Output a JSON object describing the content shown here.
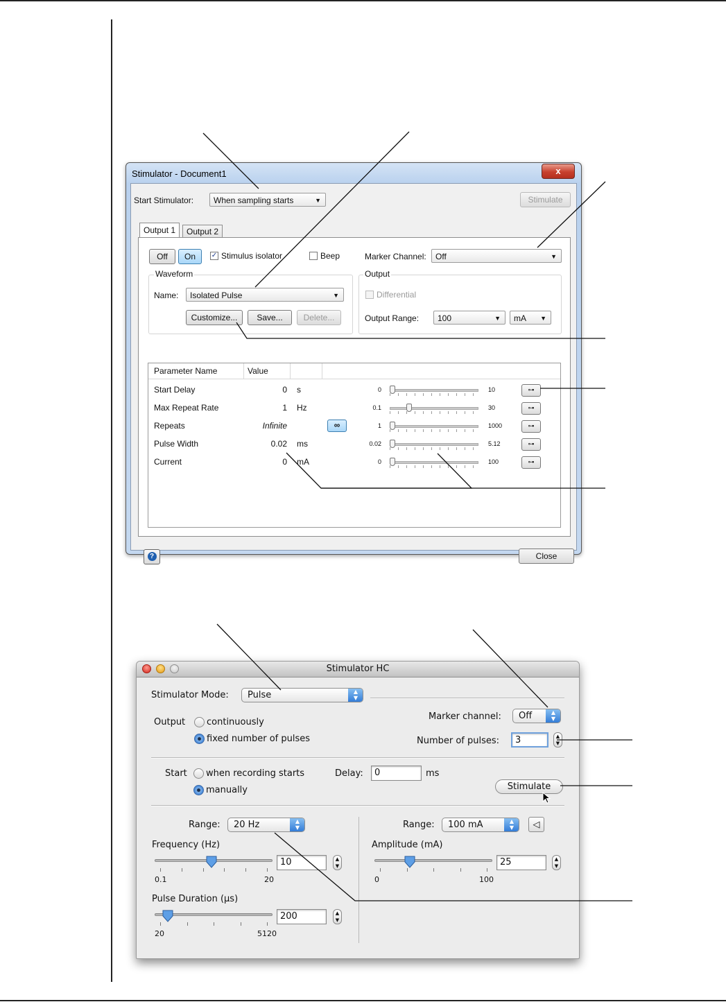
{
  "windows_dialog": {
    "title": "Stimulator - Document1",
    "close_glyph": "x",
    "start_stimulator_label": "Start Stimulator:",
    "start_stimulator_value": "When sampling starts",
    "stimulate_label": "Stimulate",
    "tabs": [
      "Output 1",
      "Output 2"
    ],
    "off_label": "Off",
    "on_label": "On",
    "stimulus_isolator_label": "Stimulus isolator",
    "stimulus_isolator_checked": true,
    "beep_label": "Beep",
    "beep_checked": false,
    "marker_channel_label": "Marker Channel:",
    "marker_channel_value": "Off",
    "waveform_group": "Waveform",
    "name_label": "Name:",
    "name_value": "Isolated Pulse",
    "customize_label": "Customize...",
    "save_label": "Save...",
    "delete_label": "Delete...",
    "output_group": "Output",
    "differential_label": "Differential",
    "output_range_label": "Output Range:",
    "output_range_value": "100",
    "output_unit_value": "mA",
    "table_headers": [
      "Parameter Name",
      "Value"
    ],
    "parameters": [
      {
        "name": "Start Delay",
        "value": "0",
        "unit": "s",
        "min": "0",
        "max": "10",
        "fraction": 0.0
      },
      {
        "name": "Max Repeat Rate",
        "value": "1",
        "unit": "Hz",
        "min": "0.1",
        "max": "30",
        "fraction": 0.2
      },
      {
        "name": "Repeats",
        "value": "Infinite",
        "unit": "",
        "min": "1",
        "max": "1000",
        "fraction": 0.0
      },
      {
        "name": "Pulse Width",
        "value": "0.02",
        "unit": "ms",
        "min": "0.02",
        "max": "5.12",
        "fraction": 0.0
      },
      {
        "name": "Current",
        "value": "0",
        "unit": "mA",
        "min": "0",
        "max": "100",
        "fraction": 0.0
      }
    ],
    "infinite_glyph": "∞",
    "help_glyph": "?",
    "close_label": "Close"
  },
  "mac_dialog": {
    "title": "Stimulator HC",
    "mode_label": "Stimulator Mode:",
    "mode_value": "Pulse",
    "output_label": "Output",
    "output_continuously": "continuously",
    "output_fixed": "fixed number of pulses",
    "marker_channel_label": "Marker channel:",
    "marker_channel_value": "Off",
    "number_of_pulses_label": "Number of pulses:",
    "number_of_pulses_value": "3",
    "start_label": "Start",
    "start_when_recording": "when recording starts",
    "start_manually": "manually",
    "delay_label": "Delay:",
    "delay_value": "0",
    "delay_unit": "ms",
    "stimulate_label": "Stimulate",
    "freq_range_label": "Range:",
    "freq_range_value": "20 Hz",
    "frequency_label": "Frequency (Hz)",
    "frequency_value": "10",
    "frequency_min": "0.1",
    "frequency_max": "20",
    "frequency_fraction": 0.48,
    "pulse_duration_label": "Pulse Duration (µs)",
    "pulse_duration_value": "200",
    "pulse_min": "20",
    "pulse_max": "5120",
    "pulse_fraction": 0.07,
    "amp_range_label": "Range:",
    "amp_range_value": "100 mA",
    "amplitude_label": "Amplitude (mA)",
    "amplitude_value": "25",
    "amplitude_min": "0",
    "amplitude_max": "100",
    "amplitude_fraction": 0.28,
    "speaker_glyph": "◁"
  },
  "colors": {
    "win_frame": "#c4d8f0",
    "win_close": "#c7402e",
    "mac_accent": "#2f79d6",
    "mac_window": "#ececec"
  }
}
